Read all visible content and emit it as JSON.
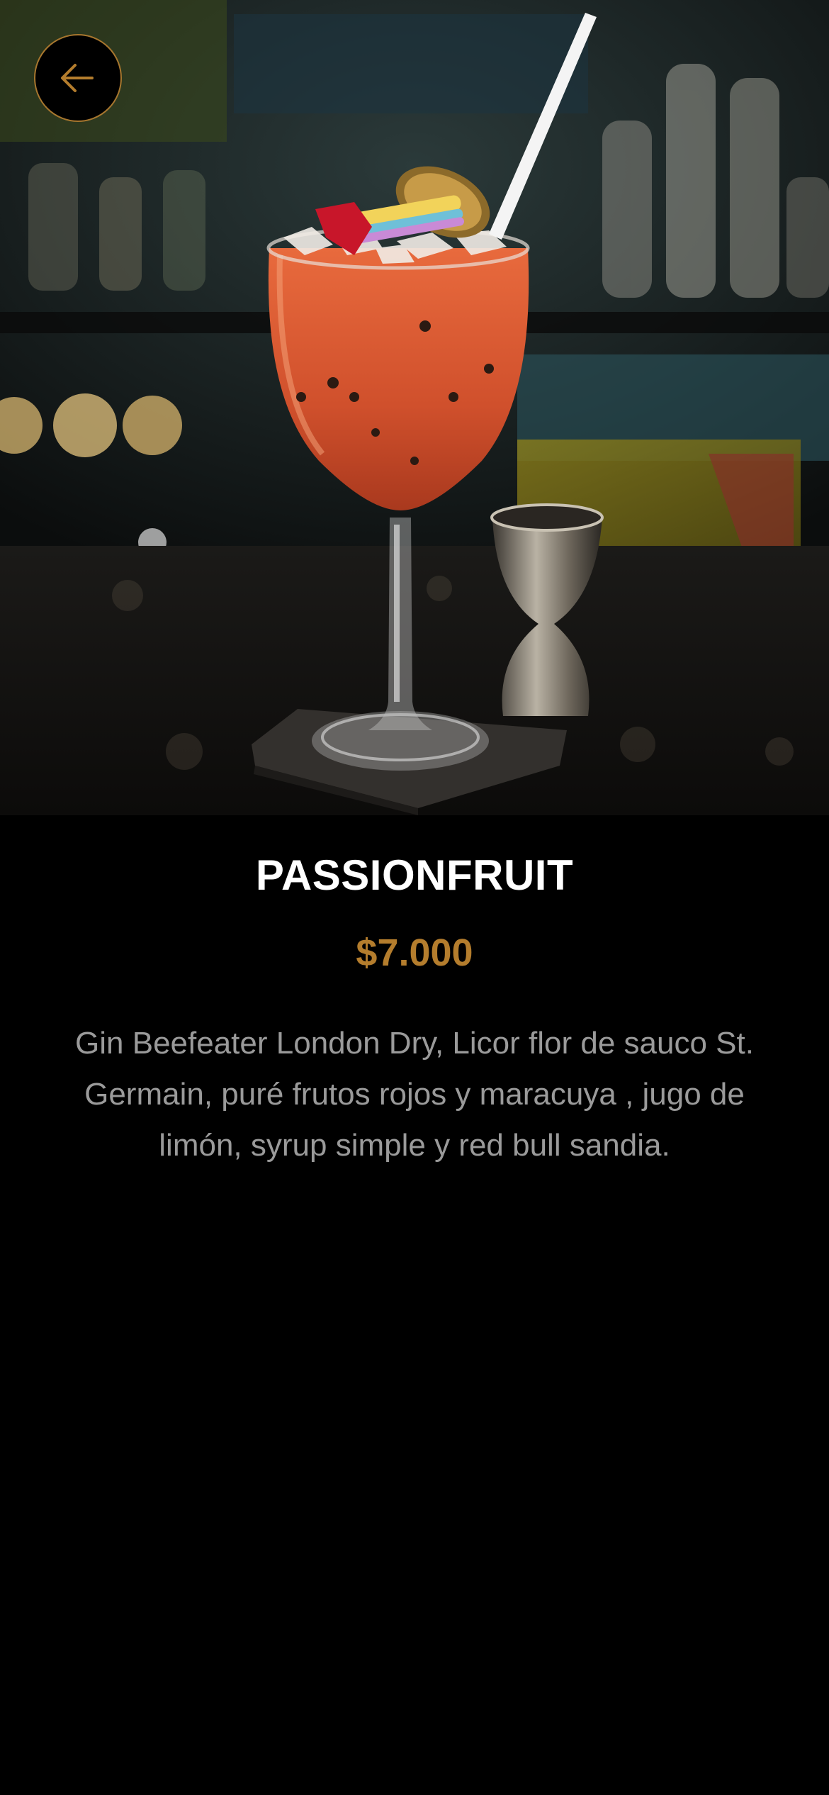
{
  "hero": {
    "image_description": "Passionfruit cocktail in stemmed glass with straw and garnish on slate coaster, bar background, jigger beside it"
  },
  "nav": {
    "back_icon": "arrow-left-icon",
    "accent_color": "#b47d2d"
  },
  "product": {
    "name": "PASSIONFRUIT",
    "price": "$7.000",
    "description": "Gin Beefeater London Dry, Licor flor de sauco St. Germain, puré frutos rojos y maracuya , jugo de limón, syrup simple y red bull sandia."
  },
  "colors": {
    "background": "#000000",
    "title": "#ffffff",
    "price": "#b47d2d",
    "description": "#9a9a9a"
  }
}
